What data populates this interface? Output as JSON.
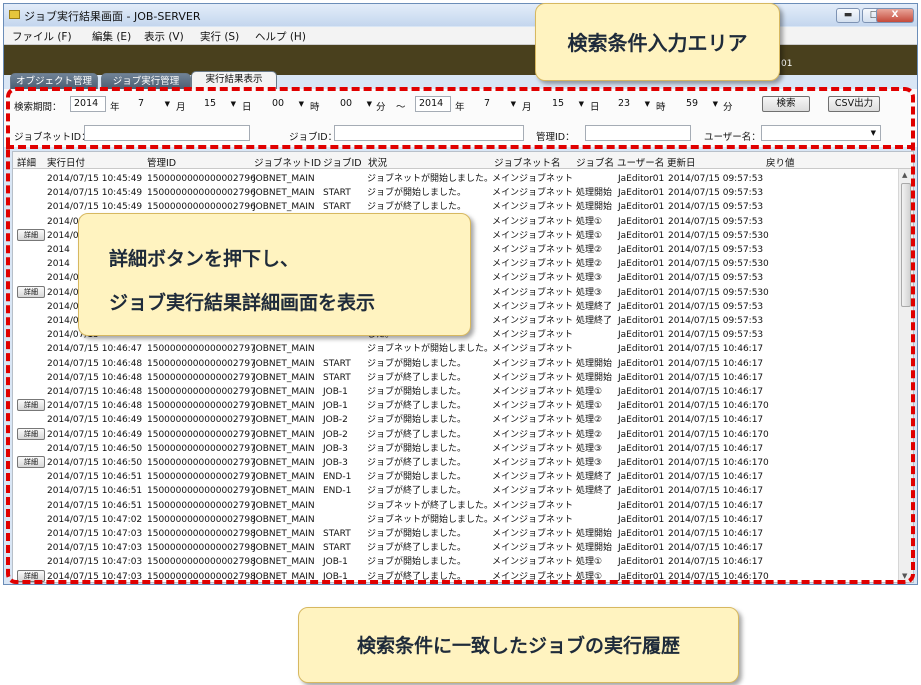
{
  "window": {
    "title": "ジョブ実行結果画面 - JOB-SERVER",
    "min": "▬",
    "max": "□",
    "close": "X"
  },
  "menu": [
    "ファイル (F)",
    "編集 (E)",
    "表示 (V)",
    "実行 (S)",
    "ヘルプ (H)"
  ],
  "header_band": {
    "version_fragment": "01"
  },
  "tabs": [
    "オブジェクト管理",
    "ジョブ実行管理",
    "実行結果表示"
  ],
  "active_tab": "実行結果表示",
  "search": {
    "period_label": "検索期間：",
    "from": {
      "year": "2014",
      "month": "7",
      "day": "15",
      "hour": "00",
      "minute": "00"
    },
    "to": {
      "year": "2014",
      "month": "7",
      "day": "15",
      "hour": "23",
      "minute": "59"
    },
    "units": {
      "year": "年",
      "month": "月",
      "day": "日",
      "hour": "時",
      "minute": "分"
    },
    "tilde": "～",
    "search_button": "検索",
    "csv_button": "CSV出力",
    "jobnet_id_label": "ジョブネットID：",
    "jobnet_id_value": "",
    "job_id_label": "ジョブID：",
    "job_id_value": "",
    "manage_id_label": "管理ID：",
    "manage_id_value": "",
    "user_label": "ユーザー名：",
    "user_value": ""
  },
  "table": {
    "headers": [
      "詳細",
      "実行日付",
      "管理ID",
      "ジョブネットID",
      "ジョブID",
      "状況",
      "ジョブネット名",
      "ジョブ名",
      "ユーザー名",
      "更新日",
      "戻り値"
    ],
    "detail_button_label": "詳細",
    "rows": [
      {
        "detail": false,
        "date": "2014/07/15 10:45:49",
        "mid": "1500000000000002796",
        "jobnet": "JOBNET_MAIN",
        "job": "",
        "status": "ジョブネットが開始しました。",
        "jobnet_name": "メインジョブネット",
        "job_name": "",
        "user": "JaEditor01",
        "updated": "2014/07/15 09:57:53",
        "ret": ""
      },
      {
        "detail": false,
        "date": "2014/07/15 10:45:49",
        "mid": "1500000000000002796",
        "jobnet": "JOBNET_MAIN",
        "job": "START",
        "status": "ジョブが開始しました。",
        "jobnet_name": "メインジョブネット",
        "job_name": "処理開始",
        "user": "JaEditor01",
        "updated": "2014/07/15 09:57:53",
        "ret": ""
      },
      {
        "detail": false,
        "date": "2014/07/15 10:45:49",
        "mid": "1500000000000002796",
        "jobnet": "JOBNET_MAIN",
        "job": "START",
        "status": "ジョブが終了しました。",
        "jobnet_name": "メインジョブネット",
        "job_name": "処理開始",
        "user": "JaEditor01",
        "updated": "2014/07/15 09:57:53",
        "ret": ""
      },
      {
        "detail": false,
        "date": "2014/07/15",
        "mid": "",
        "jobnet": "",
        "job": "",
        "status": "",
        "jobnet_name": "メインジョブネット",
        "job_name": "処理①",
        "user": "JaEditor01",
        "updated": "2014/07/15 09:57:53",
        "ret": ""
      },
      {
        "detail": true,
        "date": "2014/07/15",
        "mid": "",
        "jobnet": "",
        "job": "",
        "status": "",
        "jobnet_name": "メインジョブネット",
        "job_name": "処理①",
        "user": "JaEditor01",
        "updated": "2014/07/15 09:57:53",
        "ret": "0"
      },
      {
        "detail": false,
        "date": "2014",
        "mid": "",
        "jobnet": "",
        "job": "",
        "status": "",
        "jobnet_name": "メインジョブネット",
        "job_name": "処理②",
        "user": "JaEditor01",
        "updated": "2014/07/15 09:57:53",
        "ret": ""
      },
      {
        "detail": false,
        "date": "2014",
        "mid": "",
        "jobnet": "",
        "job": "",
        "status": "",
        "jobnet_name": "メインジョブネット",
        "job_name": "処理②",
        "user": "JaEditor01",
        "updated": "2014/07/15 09:57:53",
        "ret": "0"
      },
      {
        "detail": false,
        "date": "2014/07/",
        "mid": "",
        "jobnet": "",
        "job": "",
        "status": "",
        "jobnet_name": "メインジョブネット",
        "job_name": "処理③",
        "user": "JaEditor01",
        "updated": "2014/07/15 09:57:53",
        "ret": ""
      },
      {
        "detail": true,
        "date": "2014/07/",
        "mid": "",
        "jobnet": "",
        "job": "",
        "status": "",
        "jobnet_name": "メインジョブネット",
        "job_name": "処理③",
        "user": "JaEditor01",
        "updated": "2014/07/15 09:57:53",
        "ret": "0"
      },
      {
        "detail": false,
        "date": "2014/07/",
        "mid": "",
        "jobnet": "",
        "job": "",
        "status": "",
        "jobnet_name": "メインジョブネット",
        "job_name": "処理終了",
        "user": "JaEditor01",
        "updated": "2014/07/15 09:57:53",
        "ret": ""
      },
      {
        "detail": false,
        "date": "2014/07/",
        "mid": "",
        "jobnet": "",
        "job": "",
        "status": "",
        "jobnet_name": "メインジョブネット",
        "job_name": "処理終了",
        "user": "JaEditor01",
        "updated": "2014/07/15 09:57:53",
        "ret": ""
      },
      {
        "detail": false,
        "date": "2014/07/15",
        "mid": "",
        "jobnet": "",
        "job": "",
        "status": "した。",
        "jobnet_name": "メインジョブネット",
        "job_name": "",
        "user": "JaEditor01",
        "updated": "2014/07/15 09:57:53",
        "ret": ""
      },
      {
        "detail": false,
        "date": "2014/07/15 10:46:47",
        "mid": "1500000000000002797",
        "jobnet": "JOBNET_MAIN",
        "job": "",
        "status": "ジョブネットが開始しました。",
        "jobnet_name": "メインジョブネット",
        "job_name": "",
        "user": "JaEditor01",
        "updated": "2014/07/15 10:46:17",
        "ret": ""
      },
      {
        "detail": false,
        "date": "2014/07/15 10:46:48",
        "mid": "1500000000000002797",
        "jobnet": "JOBNET_MAIN",
        "job": "START",
        "status": "ジョブが開始しました。",
        "jobnet_name": "メインジョブネット",
        "job_name": "処理開始",
        "user": "JaEditor01",
        "updated": "2014/07/15 10:46:17",
        "ret": ""
      },
      {
        "detail": false,
        "date": "2014/07/15 10:46:48",
        "mid": "1500000000000002797",
        "jobnet": "JOBNET_MAIN",
        "job": "START",
        "status": "ジョブが終了しました。",
        "jobnet_name": "メインジョブネット",
        "job_name": "処理開始",
        "user": "JaEditor01",
        "updated": "2014/07/15 10:46:17",
        "ret": ""
      },
      {
        "detail": false,
        "date": "2014/07/15 10:46:48",
        "mid": "1500000000000002797",
        "jobnet": "JOBNET_MAIN",
        "job": "JOB-1",
        "status": "ジョブが開始しました。",
        "jobnet_name": "メインジョブネット",
        "job_name": "処理①",
        "user": "JaEditor01",
        "updated": "2014/07/15 10:46:17",
        "ret": ""
      },
      {
        "detail": true,
        "date": "2014/07/15 10:46:48",
        "mid": "1500000000000002797",
        "jobnet": "JOBNET_MAIN",
        "job": "JOB-1",
        "status": "ジョブが終了しました。",
        "jobnet_name": "メインジョブネット",
        "job_name": "処理①",
        "user": "JaEditor01",
        "updated": "2014/07/15 10:46:17",
        "ret": "0"
      },
      {
        "detail": false,
        "date": "2014/07/15 10:46:49",
        "mid": "1500000000000002797",
        "jobnet": "JOBNET_MAIN",
        "job": "JOB-2",
        "status": "ジョブが開始しました。",
        "jobnet_name": "メインジョブネット",
        "job_name": "処理②",
        "user": "JaEditor01",
        "updated": "2014/07/15 10:46:17",
        "ret": ""
      },
      {
        "detail": true,
        "date": "2014/07/15 10:46:49",
        "mid": "1500000000000002797",
        "jobnet": "JOBNET_MAIN",
        "job": "JOB-2",
        "status": "ジョブが終了しました。",
        "jobnet_name": "メインジョブネット",
        "job_name": "処理②",
        "user": "JaEditor01",
        "updated": "2014/07/15 10:46:17",
        "ret": "0"
      },
      {
        "detail": false,
        "date": "2014/07/15 10:46:50",
        "mid": "1500000000000002797",
        "jobnet": "JOBNET_MAIN",
        "job": "JOB-3",
        "status": "ジョブが開始しました。",
        "jobnet_name": "メインジョブネット",
        "job_name": "処理③",
        "user": "JaEditor01",
        "updated": "2014/07/15 10:46:17",
        "ret": ""
      },
      {
        "detail": true,
        "date": "2014/07/15 10:46:50",
        "mid": "1500000000000002797",
        "jobnet": "JOBNET_MAIN",
        "job": "JOB-3",
        "status": "ジョブが終了しました。",
        "jobnet_name": "メインジョブネット",
        "job_name": "処理③",
        "user": "JaEditor01",
        "updated": "2014/07/15 10:46:17",
        "ret": "0"
      },
      {
        "detail": false,
        "date": "2014/07/15 10:46:51",
        "mid": "1500000000000002797",
        "jobnet": "JOBNET_MAIN",
        "job": "END-1",
        "status": "ジョブが開始しました。",
        "jobnet_name": "メインジョブネット",
        "job_name": "処理終了",
        "user": "JaEditor01",
        "updated": "2014/07/15 10:46:17",
        "ret": ""
      },
      {
        "detail": false,
        "date": "2014/07/15 10:46:51",
        "mid": "1500000000000002797",
        "jobnet": "JOBNET_MAIN",
        "job": "END-1",
        "status": "ジョブが終了しました。",
        "jobnet_name": "メインジョブネット",
        "job_name": "処理終了",
        "user": "JaEditor01",
        "updated": "2014/07/15 10:46:17",
        "ret": ""
      },
      {
        "detail": false,
        "date": "2014/07/15 10:46:51",
        "mid": "1500000000000002797",
        "jobnet": "JOBNET_MAIN",
        "job": "",
        "status": "ジョブネットが終了しました。",
        "jobnet_name": "メインジョブネット",
        "job_name": "",
        "user": "JaEditor01",
        "updated": "2014/07/15 10:46:17",
        "ret": ""
      },
      {
        "detail": false,
        "date": "2014/07/15 10:47:02",
        "mid": "1500000000000002798",
        "jobnet": "JOBNET_MAIN",
        "job": "",
        "status": "ジョブネットが開始しました。",
        "jobnet_name": "メインジョブネット",
        "job_name": "",
        "user": "JaEditor01",
        "updated": "2014/07/15 10:46:17",
        "ret": ""
      },
      {
        "detail": false,
        "date": "2014/07/15 10:47:03",
        "mid": "1500000000000002798",
        "jobnet": "JOBNET_MAIN",
        "job": "START",
        "status": "ジョブが開始しました。",
        "jobnet_name": "メインジョブネット",
        "job_name": "処理開始",
        "user": "JaEditor01",
        "updated": "2014/07/15 10:46:17",
        "ret": ""
      },
      {
        "detail": false,
        "date": "2014/07/15 10:47:03",
        "mid": "1500000000000002798",
        "jobnet": "JOBNET_MAIN",
        "job": "START",
        "status": "ジョブが終了しました。",
        "jobnet_name": "メインジョブネット",
        "job_name": "処理開始",
        "user": "JaEditor01",
        "updated": "2014/07/15 10:46:17",
        "ret": ""
      },
      {
        "detail": false,
        "date": "2014/07/15 10:47:03",
        "mid": "1500000000000002798",
        "jobnet": "JOBNET_MAIN",
        "job": "JOB-1",
        "status": "ジョブが開始しました。",
        "jobnet_name": "メインジョブネット",
        "job_name": "処理①",
        "user": "JaEditor01",
        "updated": "2014/07/15 10:46:17",
        "ret": ""
      },
      {
        "detail": true,
        "date": "2014/07/15 10:47:03",
        "mid": "1500000000000002798",
        "jobnet": "JOBNET_MAIN",
        "job": "JOB-1",
        "status": "ジョブが終了しました。",
        "jobnet_name": "メインジョブネット",
        "job_name": "処理①",
        "user": "JaEditor01",
        "updated": "2014/07/15 10:46:17",
        "ret": "0"
      }
    ]
  },
  "callouts": {
    "search_area": "検索条件入力エリア",
    "detail_line1": "詳細ボタンを押下し、",
    "detail_line2": "ジョブ実行結果詳細画面を表示",
    "history": "検索条件に一致したジョブの実行履歴"
  },
  "colors": {
    "highlight": "#e00000",
    "callout_bg": "#fff3c0",
    "band": "#49401d"
  }
}
